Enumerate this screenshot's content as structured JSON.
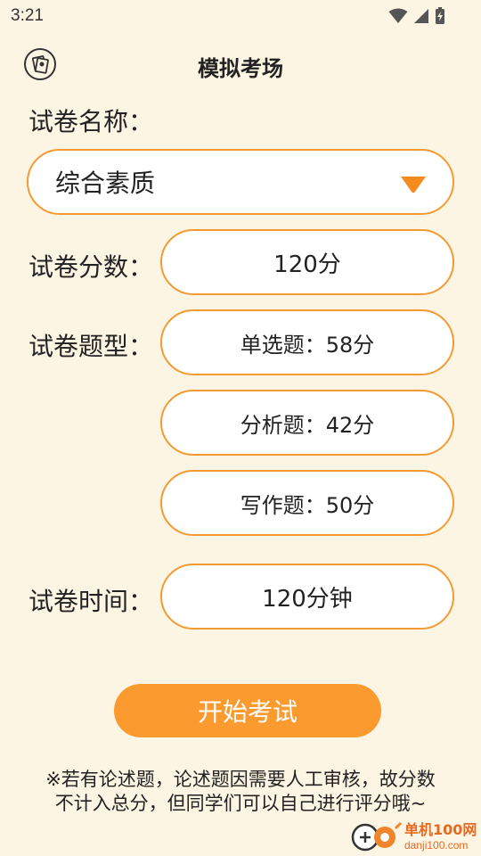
{
  "status_bar": {
    "time": "3:21",
    "icons": [
      "wifi-icon",
      "signal-icon",
      "battery-charging-icon"
    ]
  },
  "header": {
    "title": "模拟考场",
    "back_icon": "exam-back-icon"
  },
  "paper_name": {
    "label": "试卷名称：",
    "selected": "综合素质",
    "dropdown_icon": "triangle-down-icon"
  },
  "score": {
    "label": "试卷分数：",
    "value": "120分"
  },
  "question_types": {
    "label": "试卷题型：",
    "items": [
      {
        "text": "单选题：58分"
      },
      {
        "text": "分析题：42分"
      },
      {
        "text": "写作题：50分"
      }
    ]
  },
  "duration": {
    "label": "试卷时间：",
    "value": "120分钟"
  },
  "start_button": {
    "label": "开始考试"
  },
  "note": {
    "line1": "※若有论述题，论述题因需要人工审核，故分数",
    "line2": "不计入总分，但同学们可以自己进行评分哦~"
  },
  "watermark": {
    "name": "单机100网",
    "url": "danji100.com"
  },
  "colors": {
    "background": "#fdf5e3",
    "accent": "#fb9a2f",
    "border": "#f49a33"
  }
}
